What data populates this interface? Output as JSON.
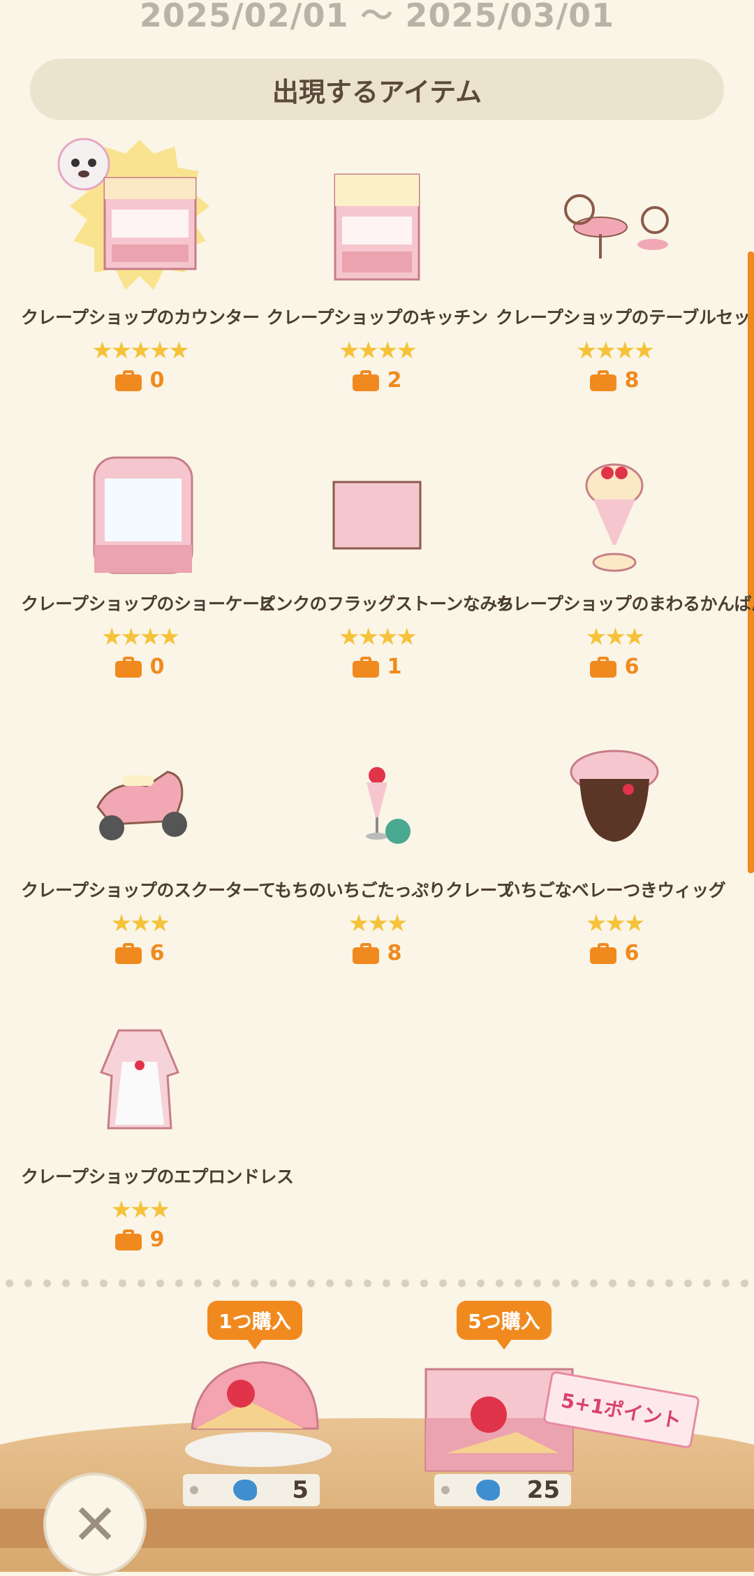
{
  "date_range": "2025/02/01 〜 2025/03/01",
  "section_title": "出現するアイテム",
  "items": [
    {
      "name": "クレープショップのカウンター",
      "stars": "★★★★★",
      "count": "0"
    },
    {
      "name": "クレープショップのキッチン",
      "stars": "★★★★",
      "count": "2"
    },
    {
      "name": "クレープショップのテーブルセット",
      "stars": "★★★★",
      "count": "8"
    },
    {
      "name": "クレープショップのショーケース",
      "stars": "★★★★",
      "count": "0"
    },
    {
      "name": "ピンクのフラッグストーンなみち",
      "stars": "★★★★",
      "count": "1"
    },
    {
      "name": "クレープショップのまわるかんばん",
      "stars": "★★★",
      "count": "6"
    },
    {
      "name": "クレープショップのスクーター",
      "stars": "★★★",
      "count": "6"
    },
    {
      "name": "てもちのいちごたっぷりクレープ",
      "stars": "★★★",
      "count": "8"
    },
    {
      "name": "いちごなベレーつきウィッグ",
      "stars": "★★★",
      "count": "6"
    },
    {
      "name": "クレープショップのエプロンドレス",
      "stars": "★★★",
      "count": "9"
    }
  ],
  "purchase": {
    "single": {
      "label": "1つ購入",
      "price": "5"
    },
    "five": {
      "label": "5つ購入",
      "price": "25",
      "bonus": "5+1ポイント"
    }
  },
  "icons": {
    "bag": "bag-icon",
    "leaf_ticket": "leaf-ticket-icon",
    "close": "close-icon"
  },
  "colors": {
    "accent": "#f08a1f",
    "star": "#f5c23a",
    "background": "#faf5e6"
  }
}
